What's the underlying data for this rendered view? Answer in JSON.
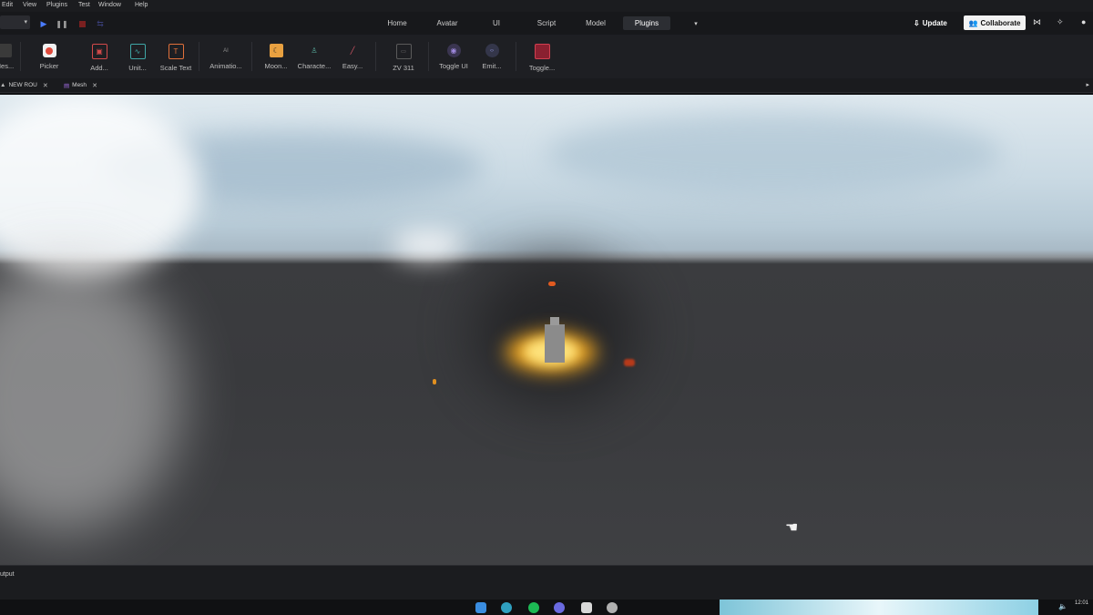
{
  "menu": [
    "Edit",
    "View",
    "Plugins",
    "Test",
    "Window",
    "Help"
  ],
  "top_tabs": [
    {
      "label": "Home",
      "active": false
    },
    {
      "label": "Avatar",
      "active": false
    },
    {
      "label": "UI",
      "active": false
    },
    {
      "label": "Script",
      "active": false
    },
    {
      "label": "Model",
      "active": false
    },
    {
      "label": "Plugins",
      "active": true
    }
  ],
  "header": {
    "update_label": "Update",
    "collaborate_label": "Collaborate"
  },
  "ribbon": [
    {
      "label": "Mes...",
      "icon": "mesh-icon",
      "color": "#9a9a9a"
    },
    {
      "label": "Picker",
      "icon": "picker-icon",
      "color": "#e04a3c"
    },
    {
      "label": "Add...",
      "icon": "add-icon",
      "color": "#d24a4a"
    },
    {
      "label": "Unit...",
      "icon": "unit-icon",
      "color": "#3fa6a6"
    },
    {
      "label": "Scale Text",
      "icon": "scale-text-icon",
      "color": "#e0703a"
    },
    {
      "label": "Animatio...",
      "icon": "animation-icon",
      "color": "#8a8a8a"
    },
    {
      "label": "Moon...",
      "icon": "moon-icon",
      "color": "#e8a040"
    },
    {
      "label": "Characte...",
      "icon": "character-icon",
      "color": "#5ab0a0"
    },
    {
      "label": "Easy...",
      "icon": "easy-icon",
      "color": "#e05a6a"
    },
    {
      "label": "ZV 311",
      "icon": "zv-icon",
      "color": "#7a7a7a"
    },
    {
      "label": "Toggle UI",
      "icon": "toggle-ui-icon",
      "color": "#a08adf"
    },
    {
      "label": "Emit...",
      "icon": "emit-icon",
      "color": "#8a8fd0"
    },
    {
      "label": "Toggle...",
      "icon": "toggle-icon",
      "color": "#d04050"
    }
  ],
  "doc_tabs": [
    {
      "label": "NEW ROU",
      "icon": "place-icon"
    },
    {
      "label": "Mesh",
      "icon": "mesh-doc-icon"
    }
  ],
  "output": {
    "label": "utput"
  },
  "taskbar": {
    "clock": "12:01"
  }
}
